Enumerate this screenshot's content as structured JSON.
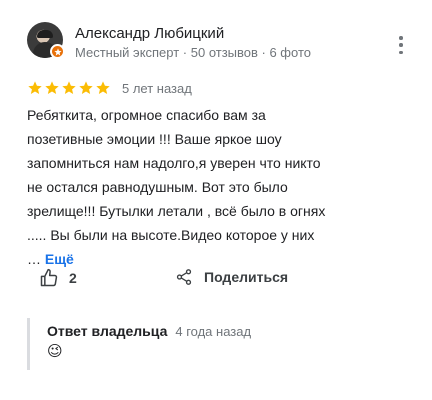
{
  "reviewer": {
    "name": "Александр Любицкий",
    "meta": "Местный эксперт · 50 отзывов · 6 фото"
  },
  "review": {
    "rating": 5,
    "rating_max": 5,
    "time": "5 лет назад",
    "text": "Ребяткита, огромное спасибо вам за позетивные эмоции !!! Ваше яркое шоу запомниться нам надолго,я уверен что никто не остался равнодушным. Вот это было зрелище!!! Бутылки летали , всё было в огнях ..... Вы были на высоте.Видео которое у них … ",
    "more_label": "Ещё"
  },
  "actions": {
    "like_count": "2",
    "share_label": "Поделиться"
  },
  "owner_response": {
    "title": "Ответ владельца",
    "time": "4 года назад",
    "text": "😉"
  },
  "colors": {
    "star": "#fbbc04",
    "link": "#1a73e8",
    "badge": "#e8710a",
    "secondary_text": "#70757a"
  },
  "icons": {
    "menu": "more-vert-icon",
    "like": "thumb-up-icon",
    "share": "share-icon",
    "badge": "local-guide-badge-icon"
  }
}
